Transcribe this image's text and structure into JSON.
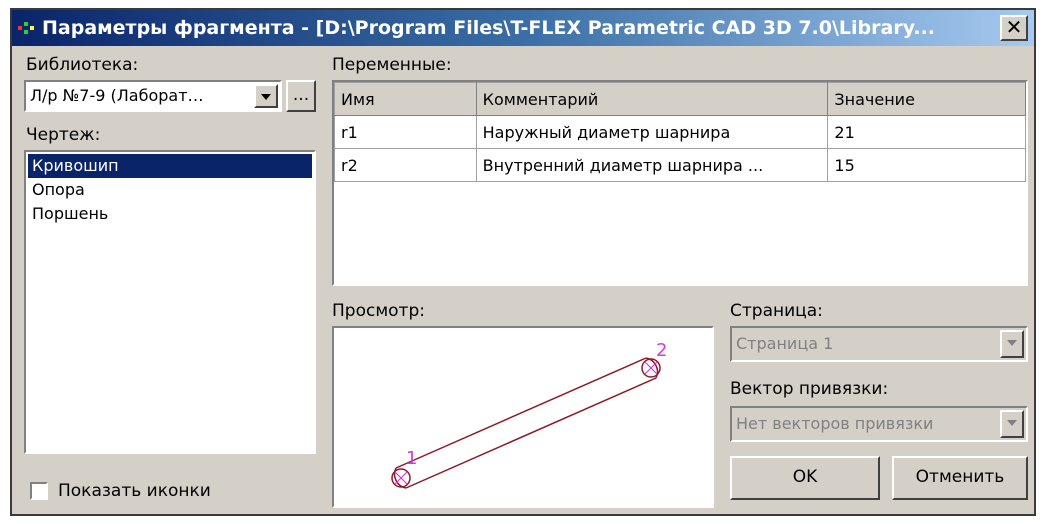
{
  "window": {
    "title": "Параметры фрагмента - [D:\\Program Files\\T-FLEX Parametric CAD 3D 7.0\\Library...",
    "close_glyph": "✕"
  },
  "library": {
    "label": "Библиотека:",
    "value": "Л/р №7-9 (Лаборат…",
    "browse_label": "..."
  },
  "drawing": {
    "label": "Чертеж:",
    "items": [
      {
        "label": "Кривошип",
        "selected": true
      },
      {
        "label": "Опора",
        "selected": false
      },
      {
        "label": "Поршень",
        "selected": false
      }
    ]
  },
  "show_icons": {
    "label": "Показать иконки",
    "checked": false
  },
  "variables": {
    "label": "Переменные:",
    "columns": [
      "Имя",
      "Комментарий",
      "Значение"
    ],
    "rows": [
      [
        "r1",
        "Наружный диаметр шарнира",
        "21"
      ],
      [
        "r2",
        "Внутренний диаметр шарнира ...",
        "15"
      ]
    ]
  },
  "preview": {
    "label": "Просмотр:",
    "point_labels": [
      "1",
      "2"
    ],
    "line_color": "#8b1a2b",
    "point_color": "#d040d0"
  },
  "page": {
    "label": "Страница:",
    "value": "Страница 1"
  },
  "anchor_vector": {
    "label": "Вектор привязки:",
    "value": "Нет векторов привязки"
  },
  "buttons": {
    "ok": "OK",
    "cancel": "Отменить"
  },
  "colors": {
    "titlebar_start": "#0a246a",
    "dialog_bg": "#d4d0c8",
    "selection": "#0a246a"
  }
}
